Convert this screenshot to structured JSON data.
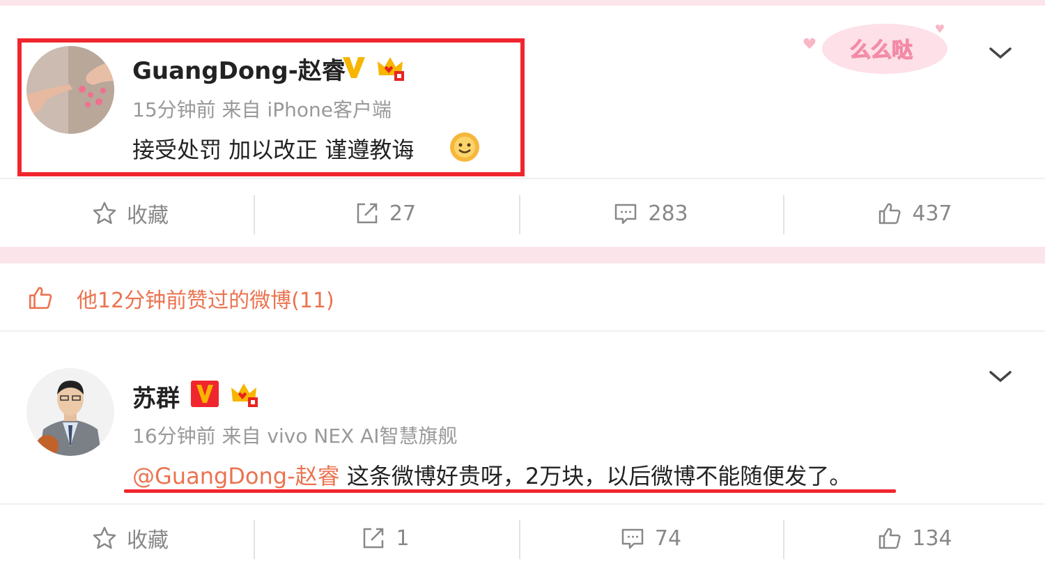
{
  "post1": {
    "username": "GuangDong-赵睿",
    "meta": "15分钟前 来自 iPhone客户端",
    "text": "接受处罚 加以改正 谨遵教诲",
    "actions": {
      "favorite_label": "收藏",
      "repost_count": "27",
      "comment_count": "283",
      "like_count": "437"
    }
  },
  "liked_notice": "他12分钟前赞过的微博(11)",
  "post2": {
    "username": "苏群",
    "meta": "16分钟前 来自 vivo NEX AI智慧旗舰",
    "mention": "@GuangDong-赵睿",
    "text": " 这条微博好贵呀，2万块，以后微博不能随便发了。",
    "actions": {
      "favorite_label": "收藏",
      "repost_count": "1",
      "comment_count": "74",
      "like_count": "134"
    }
  },
  "decoration_text": "么么哒",
  "colors": {
    "accent": "#eb7350",
    "highlight": "#f0262e",
    "verified": "#f7b500",
    "band": "#fbe4ea"
  }
}
